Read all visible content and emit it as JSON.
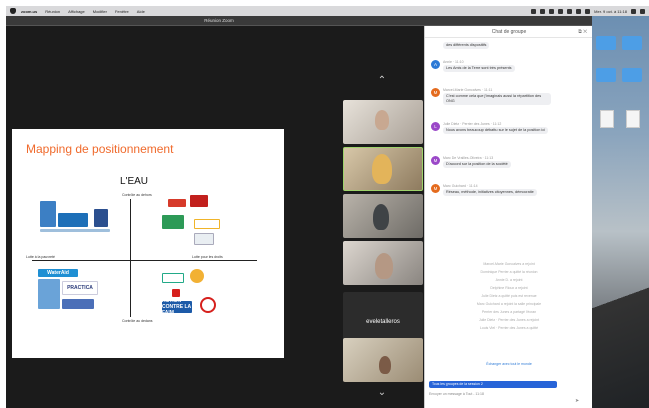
{
  "menubar": {
    "app_name": "zoom.us",
    "items": [
      "Réunion",
      "Affichage",
      "Modifier",
      "Fenêtre",
      "Aide"
    ],
    "clock": "Mer. 9 oct. à 11:18"
  },
  "window": {
    "title": "Réunion Zoom"
  },
  "slide": {
    "title": "Mapping de positionnement",
    "heading": "L'EAU",
    "axis_top": "Contrôle au dehors",
    "axis_bottom": "Contrôle au dedans",
    "axis_left": "Lutte à la pauvreté",
    "axis_right": "Lutte pour les droits",
    "logos": [
      "WaterAid",
      "PRACTICA",
      "ACTION CONTRE LA FAIM",
      "Les Amis de la Terre",
      "GRET",
      "Eau Vive",
      "Solidarités",
      "PS-Eau",
      "France Libertés",
      "Coalition Eau",
      "Emmaüs",
      "Sherpa"
    ]
  },
  "participants": {
    "name_tile": "eveletalleros"
  },
  "chat": {
    "header": "Chat de groupe",
    "messages": [
      {
        "initial": "",
        "color": "#2d7ad6",
        "name": "",
        "text": "des différents dispositifs"
      },
      {
        "initial": "A",
        "color": "#2d7ad6",
        "name": "Annie · 11:10",
        "text": "Les Amis de la Terre sont très présents"
      },
      {
        "initial": "M",
        "color": "#e46b1e",
        "name": "Marcel-Marie Goncalves · 11:11",
        "text": "C'est comme cela que j'imaginais aussi la répartition des ONG"
      },
      {
        "initial": "L",
        "color": "#9b48c8",
        "name": "Julie Dietz · Perrier des Junes · 11:12",
        "text": "Nous avons beaucoup débattu sur le sujet de la position ici"
      },
      {
        "initial": "M",
        "color": "#9b48c8",
        "name": "Marc De Vrailles-Oliveira · 11:13",
        "text": "D'accord sur la position de la société"
      },
      {
        "initial": "M",
        "color": "#e46b1e",
        "name": "Marc Guichard · 11:14",
        "text": "Réseau, méthode, initiatives citoyennes, démocratie"
      }
    ],
    "system_lines": [
      "Marcel-Marie Goncalves a rejoint",
      "Dominique Perrier a quitté la réunion",
      "Annie D. a rejoint",
      "Delphine Rioux a rejoint",
      "Julie Dietz a quitté puis est revenue",
      "Marc Guichard a rejoint la salle principale",
      "Perrier des Junes a partagé l'écran",
      "Julie Dietz · Perrier des Junes a rejoint",
      "Louis Viel · Perrier des Junes a quitté"
    ],
    "link_line": "Échanger avec tout le monde",
    "input_value": "Tous les groupes de la session 2",
    "footer": "Envoyer un message à Tout - 11:18"
  }
}
